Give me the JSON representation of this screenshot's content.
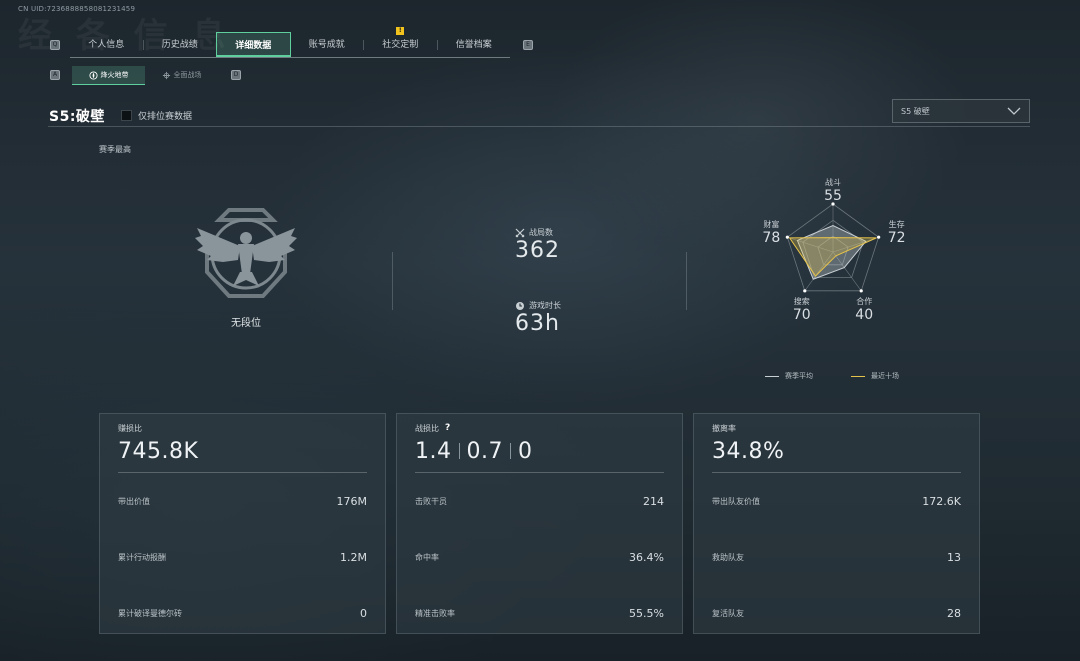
{
  "uid": "CN UID:7236888858081231459",
  "ghost_title": "经 各 信 息",
  "key_hints": {
    "q": "Q",
    "e": "E",
    "a": "A",
    "d": "D"
  },
  "tabs": [
    {
      "label": "个人信息",
      "active": false
    },
    {
      "label": "历史战绩",
      "active": false
    },
    {
      "label": "详细数据",
      "active": true
    },
    {
      "label": "账号成就",
      "active": false
    },
    {
      "label": "社交定制",
      "active": false,
      "badge": "!"
    },
    {
      "label": "信誉档案",
      "active": false
    }
  ],
  "subtabs": [
    {
      "label": "烽火地带",
      "icon": "flame-icon",
      "active": true
    },
    {
      "label": "全面战场",
      "icon": "crosshair-icon",
      "active": false
    }
  ],
  "season": {
    "title": "S5:破壁",
    "ranked_only_label": "仅排位赛数据",
    "ranked_only_checked": false,
    "selector_value": "S5 破壁"
  },
  "season_best": {
    "label": "赛季最高",
    "rank_name": "无段位"
  },
  "summary": {
    "matches_label": "战局数",
    "matches_value": "362",
    "playtime_label": "游戏时长",
    "playtime_value": "63h"
  },
  "radar": {
    "axes": [
      {
        "label": "战斗",
        "value": "55"
      },
      {
        "label": "生存",
        "value": "72"
      },
      {
        "label": "合作",
        "value": "40"
      },
      {
        "label": "搜索",
        "value": "70"
      },
      {
        "label": "财富",
        "value": "78"
      }
    ],
    "series": [
      {
        "name": "赛季平均",
        "color": "#c9d0d4",
        "values": [
          55,
          72,
          40,
          70,
          78
        ]
      },
      {
        "name": "最近十场",
        "color": "#e6c34a",
        "values": [
          30,
          95,
          10,
          62,
          95
        ]
      }
    ]
  },
  "cards": [
    {
      "title": "赚损比",
      "big": "745.8K",
      "rows": [
        {
          "label": "带出价值",
          "value": "176M"
        },
        {
          "label": "累计行动报酬",
          "value": "1.2M"
        },
        {
          "label": "累计破译曼德尔砖",
          "value": "0"
        }
      ]
    },
    {
      "title": "战损比",
      "help": "?",
      "big_parts": [
        "1.4",
        "0.7",
        "0"
      ],
      "rows": [
        {
          "label": "击败干员",
          "value": "214"
        },
        {
          "label": "命中率",
          "value": "36.4%"
        },
        {
          "label": "精准击败率",
          "value": "55.5%"
        }
      ]
    },
    {
      "title": "撤离率",
      "big": "34.8%",
      "rows": [
        {
          "label": "带出队友价值",
          "value": "172.6K"
        },
        {
          "label": "救助队友",
          "value": "13"
        },
        {
          "label": "复活队友",
          "value": "28"
        }
      ]
    }
  ],
  "colors": {
    "accent": "#5fcf9d",
    "radar_recent": "#e6c34a",
    "radar_average": "#c9d0d4",
    "notification": "#f2c31c"
  }
}
